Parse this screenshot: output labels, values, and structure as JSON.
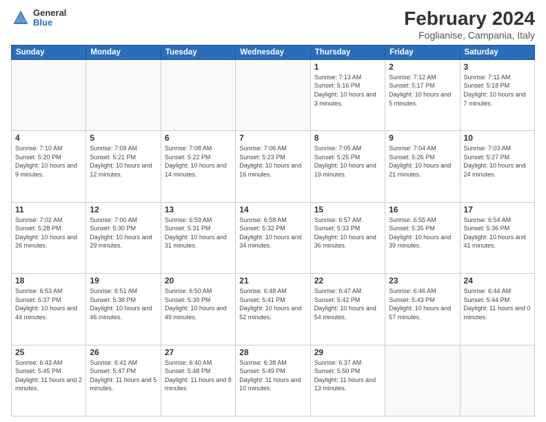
{
  "logo": {
    "general": "General",
    "blue": "Blue"
  },
  "title": "February 2024",
  "subtitle": "Foglianise, Campania, Italy",
  "weekdays": [
    "Sunday",
    "Monday",
    "Tuesday",
    "Wednesday",
    "Thursday",
    "Friday",
    "Saturday"
  ],
  "weeks": [
    [
      {
        "day": "",
        "sunrise": "",
        "sunset": "",
        "daylight": ""
      },
      {
        "day": "",
        "sunrise": "",
        "sunset": "",
        "daylight": ""
      },
      {
        "day": "",
        "sunrise": "",
        "sunset": "",
        "daylight": ""
      },
      {
        "day": "",
        "sunrise": "",
        "sunset": "",
        "daylight": ""
      },
      {
        "day": "1",
        "sunrise": "Sunrise: 7:13 AM",
        "sunset": "Sunset: 5:16 PM",
        "daylight": "Daylight: 10 hours and 3 minutes."
      },
      {
        "day": "2",
        "sunrise": "Sunrise: 7:12 AM",
        "sunset": "Sunset: 5:17 PM",
        "daylight": "Daylight: 10 hours and 5 minutes."
      },
      {
        "day": "3",
        "sunrise": "Sunrise: 7:11 AM",
        "sunset": "Sunset: 5:18 PM",
        "daylight": "Daylight: 10 hours and 7 minutes."
      }
    ],
    [
      {
        "day": "4",
        "sunrise": "Sunrise: 7:10 AM",
        "sunset": "Sunset: 5:20 PM",
        "daylight": "Daylight: 10 hours and 9 minutes."
      },
      {
        "day": "5",
        "sunrise": "Sunrise: 7:09 AM",
        "sunset": "Sunset: 5:21 PM",
        "daylight": "Daylight: 10 hours and 12 minutes."
      },
      {
        "day": "6",
        "sunrise": "Sunrise: 7:08 AM",
        "sunset": "Sunset: 5:22 PM",
        "daylight": "Daylight: 10 hours and 14 minutes."
      },
      {
        "day": "7",
        "sunrise": "Sunrise: 7:06 AM",
        "sunset": "Sunset: 5:23 PM",
        "daylight": "Daylight: 10 hours and 16 minutes."
      },
      {
        "day": "8",
        "sunrise": "Sunrise: 7:05 AM",
        "sunset": "Sunset: 5:25 PM",
        "daylight": "Daylight: 10 hours and 19 minutes."
      },
      {
        "day": "9",
        "sunrise": "Sunrise: 7:04 AM",
        "sunset": "Sunset: 5:26 PM",
        "daylight": "Daylight: 10 hours and 21 minutes."
      },
      {
        "day": "10",
        "sunrise": "Sunrise: 7:03 AM",
        "sunset": "Sunset: 5:27 PM",
        "daylight": "Daylight: 10 hours and 24 minutes."
      }
    ],
    [
      {
        "day": "11",
        "sunrise": "Sunrise: 7:02 AM",
        "sunset": "Sunset: 5:28 PM",
        "daylight": "Daylight: 10 hours and 26 minutes."
      },
      {
        "day": "12",
        "sunrise": "Sunrise: 7:00 AM",
        "sunset": "Sunset: 5:30 PM",
        "daylight": "Daylight: 10 hours and 29 minutes."
      },
      {
        "day": "13",
        "sunrise": "Sunrise: 6:59 AM",
        "sunset": "Sunset: 5:31 PM",
        "daylight": "Daylight: 10 hours and 31 minutes."
      },
      {
        "day": "14",
        "sunrise": "Sunrise: 6:58 AM",
        "sunset": "Sunset: 5:32 PM",
        "daylight": "Daylight: 10 hours and 34 minutes."
      },
      {
        "day": "15",
        "sunrise": "Sunrise: 6:57 AM",
        "sunset": "Sunset: 5:33 PM",
        "daylight": "Daylight: 10 hours and 36 minutes."
      },
      {
        "day": "16",
        "sunrise": "Sunrise: 6:55 AM",
        "sunset": "Sunset: 5:35 PM",
        "daylight": "Daylight: 10 hours and 39 minutes."
      },
      {
        "day": "17",
        "sunrise": "Sunrise: 6:54 AM",
        "sunset": "Sunset: 5:36 PM",
        "daylight": "Daylight: 10 hours and 41 minutes."
      }
    ],
    [
      {
        "day": "18",
        "sunrise": "Sunrise: 6:53 AM",
        "sunset": "Sunset: 5:37 PM",
        "daylight": "Daylight: 10 hours and 44 minutes."
      },
      {
        "day": "19",
        "sunrise": "Sunrise: 6:51 AM",
        "sunset": "Sunset: 5:38 PM",
        "daylight": "Daylight: 10 hours and 46 minutes."
      },
      {
        "day": "20",
        "sunrise": "Sunrise: 6:50 AM",
        "sunset": "Sunset: 5:39 PM",
        "daylight": "Daylight: 10 hours and 49 minutes."
      },
      {
        "day": "21",
        "sunrise": "Sunrise: 6:48 AM",
        "sunset": "Sunset: 5:41 PM",
        "daylight": "Daylight: 10 hours and 52 minutes."
      },
      {
        "day": "22",
        "sunrise": "Sunrise: 6:47 AM",
        "sunset": "Sunset: 5:42 PM",
        "daylight": "Daylight: 10 hours and 54 minutes."
      },
      {
        "day": "23",
        "sunrise": "Sunrise: 6:46 AM",
        "sunset": "Sunset: 5:43 PM",
        "daylight": "Daylight: 10 hours and 57 minutes."
      },
      {
        "day": "24",
        "sunrise": "Sunrise: 6:44 AM",
        "sunset": "Sunset: 5:44 PM",
        "daylight": "Daylight: 11 hours and 0 minutes."
      }
    ],
    [
      {
        "day": "25",
        "sunrise": "Sunrise: 6:43 AM",
        "sunset": "Sunset: 5:45 PM",
        "daylight": "Daylight: 11 hours and 2 minutes."
      },
      {
        "day": "26",
        "sunrise": "Sunrise: 6:41 AM",
        "sunset": "Sunset: 5:47 PM",
        "daylight": "Daylight: 11 hours and 5 minutes."
      },
      {
        "day": "27",
        "sunrise": "Sunrise: 6:40 AM",
        "sunset": "Sunset: 5:48 PM",
        "daylight": "Daylight: 11 hours and 8 minutes."
      },
      {
        "day": "28",
        "sunrise": "Sunrise: 6:38 AM",
        "sunset": "Sunset: 5:49 PM",
        "daylight": "Daylight: 11 hours and 10 minutes."
      },
      {
        "day": "29",
        "sunrise": "Sunrise: 6:37 AM",
        "sunset": "Sunset: 5:50 PM",
        "daylight": "Daylight: 11 hours and 13 minutes."
      },
      {
        "day": "",
        "sunrise": "",
        "sunset": "",
        "daylight": ""
      },
      {
        "day": "",
        "sunrise": "",
        "sunset": "",
        "daylight": ""
      }
    ]
  ]
}
